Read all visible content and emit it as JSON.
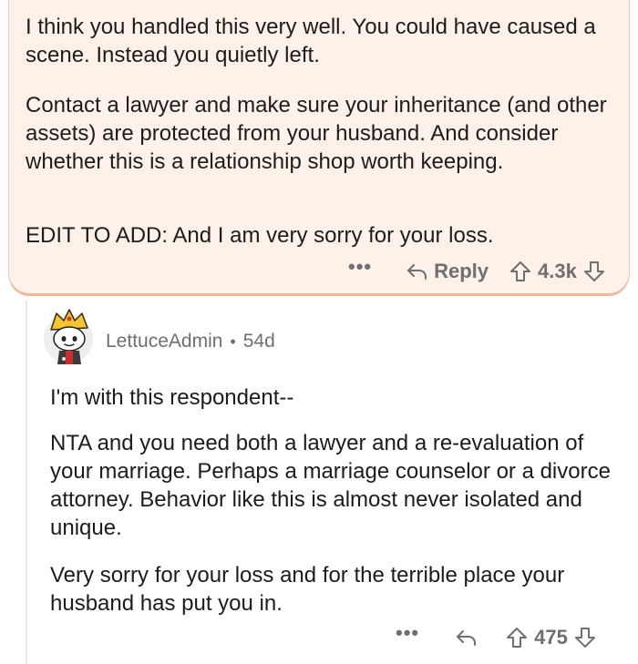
{
  "top_comment": {
    "paragraphs": [
      "I think you handled this very well.  You could have caused a scene.  Instead you quietly left.",
      "Contact a lawyer and make sure your inheritance (and other assets) are protected from your husband.  And consider whether this is a relationship shop worth keeping.",
      "EDIT TO ADD:  And I am very sorry for your loss."
    ],
    "actions": {
      "more": "•••",
      "reply_label": "Reply",
      "vote_count": "4.3k"
    },
    "icons": {
      "reply": "reply-arrow-icon",
      "upvote": "upvote-arrow-icon",
      "downvote": "downvote-arrow-icon"
    },
    "highlight_color": "#fdf1ea",
    "highlight_border": "#f3b79a"
  },
  "reply_comment": {
    "author": "LettuceAdmin",
    "separator": "•",
    "age": "54d",
    "paragraphs": [
      "I'm with this respondent--",
      "NTA and you need both a lawyer and a re-evaluation of your marriage. Perhaps a marriage counselor or a divorce attorney. Behavior like this is almost never isolated and unique.",
      "Very sorry for your loss and for the terrible place your husband has put you in."
    ],
    "actions": {
      "more": "•••",
      "vote_count": "475"
    },
    "icons": {
      "avatar": "snoo-avatar-icon",
      "reply": "reply-arrow-icon",
      "upvote": "upvote-arrow-icon",
      "downvote": "downvote-arrow-icon"
    }
  }
}
